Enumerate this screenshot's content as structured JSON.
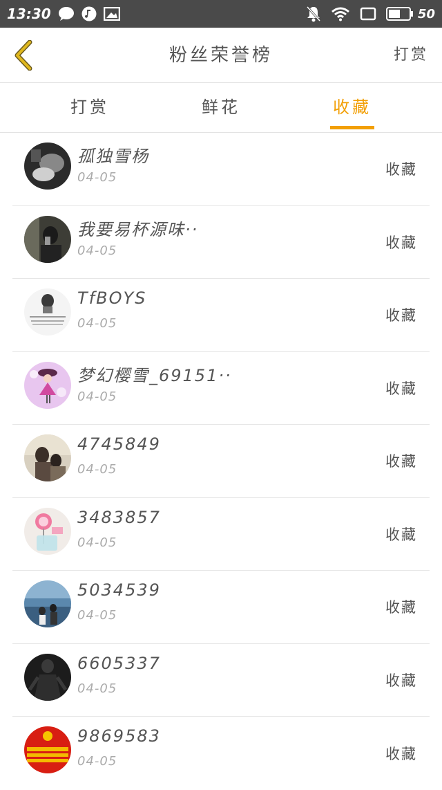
{
  "status_bar": {
    "time": "13:30",
    "battery": "50",
    "icons_left": [
      "message-icon",
      "music-icon",
      "image-icon"
    ],
    "icons_right": [
      "mute-icon",
      "wifi-icon",
      "screen-icon",
      "battery-icon"
    ]
  },
  "header": {
    "title": "粉丝荣誉榜",
    "action": "打赏"
  },
  "tabs": [
    {
      "label": "打赏",
      "active": false
    },
    {
      "label": "鲜花",
      "active": false
    },
    {
      "label": "收藏",
      "active": true
    }
  ],
  "colors": {
    "accent": "#f29f05",
    "statusbar": "#4a4a4a",
    "divider": "#e6e6e6"
  },
  "rows": [
    {
      "name": "孤独雪杨",
      "date": "04-05",
      "action": "收藏",
      "avatar": "dark-photo-avatar"
    },
    {
      "name": "我要易杯源味··",
      "date": "04-05",
      "action": "收藏",
      "avatar": "mirror-selfie-avatar"
    },
    {
      "name": "TfBOYS",
      "date": "04-05",
      "action": "收藏",
      "avatar": "text-image-avatar"
    },
    {
      "name": "梦幻樱雪_69151··",
      "date": "04-05",
      "action": "收藏",
      "avatar": "anime-girl-avatar"
    },
    {
      "name": "4745849",
      "date": "04-05",
      "action": "收藏",
      "avatar": "couple-photo-avatar"
    },
    {
      "name": "3483857",
      "date": "04-05",
      "action": "收藏",
      "avatar": "lollipop-avatar"
    },
    {
      "name": "5034539",
      "date": "04-05",
      "action": "收藏",
      "avatar": "beach-photo-avatar"
    },
    {
      "name": "6605337",
      "date": "04-05",
      "action": "收藏",
      "avatar": "dark-figure-avatar"
    },
    {
      "name": "9869583",
      "date": "04-05",
      "action": "收藏",
      "avatar": "army-day-avatar"
    }
  ]
}
